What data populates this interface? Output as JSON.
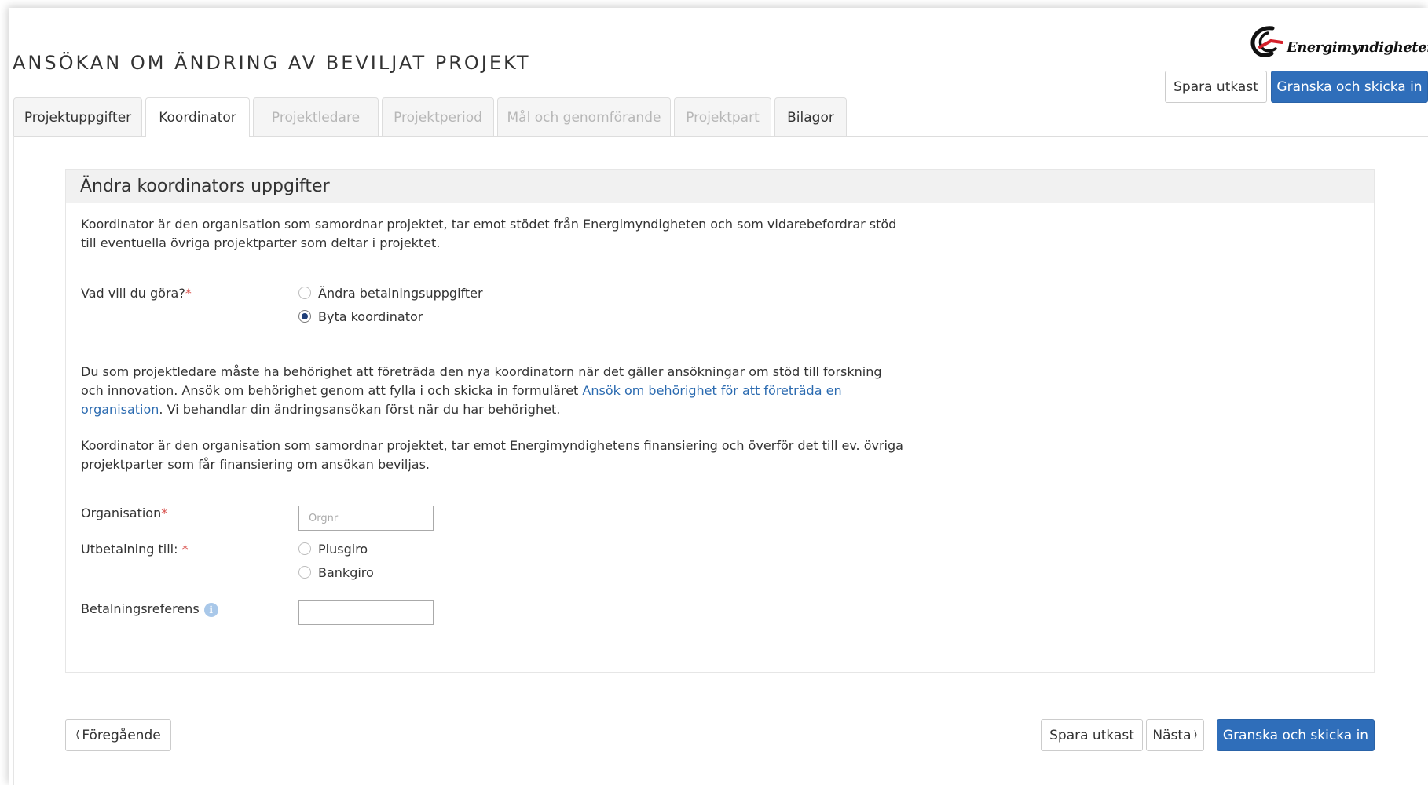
{
  "header": {
    "title": "ANSÖKAN OM ÄNDRING AV BEVILJAT PROJEKT",
    "logo_text": "Energimyndigheten",
    "save_draft_label": "Spara utkast",
    "review_submit_label": "Granska och skicka in"
  },
  "tabs": [
    {
      "label": "Projektuppgifter",
      "state": "enabled"
    },
    {
      "label": "Koordinator",
      "state": "active"
    },
    {
      "label": "Projektledare",
      "state": "disabled"
    },
    {
      "label": "Projektperiod",
      "state": "disabled"
    },
    {
      "label": "Mål och genomförande",
      "state": "disabled"
    },
    {
      "label": "Projektpart",
      "state": "disabled"
    },
    {
      "label": "Bilagor",
      "state": "enabled"
    }
  ],
  "panel": {
    "heading": "Ändra koordinators uppgifter",
    "intro": "Koordinator är den organisation som samordnar projektet, tar emot stödet från Energimyndigheten och som vidarebefordrar stöd till eventuella övriga projektparter som deltar i projektet.",
    "question_label": "Vad vill du göra?",
    "required_mark": "*",
    "options": [
      {
        "label": "Ändra betalningsuppgifter",
        "checked": false
      },
      {
        "label": "Byta koordinator",
        "checked": true
      }
    ],
    "authority_text_before": "Du som projektledare måste ha behörighet att företräda den nya koordinatorn när det gäller ansökningar om stöd till forskning och innovation. Ansök om behörighet genom att fylla i och skicka in formuläret ",
    "authority_link": "Ansök om behörighet för att företräda en organisation",
    "authority_text_after": ". Vi behandlar din ändringsansökan först när du har behörighet.",
    "financing_text": "Koordinator är den organisation som samordnar projektet, tar emot Energimyndighetens finansiering och överför det till ev. övriga projektparter som får finansiering om ansökan beviljas.",
    "organisation_label": "Organisation",
    "organisation_placeholder": "Orgnr",
    "organisation_value": "",
    "payment_label": "Utbetalning till:",
    "payment_options": [
      {
        "label": "Plusgiro",
        "checked": false
      },
      {
        "label": "Bankgiro",
        "checked": false
      }
    ],
    "reference_label": "Betalningsreferens",
    "reference_value": ""
  },
  "footer": {
    "previous_label": "Föregående",
    "save_draft_label": "Spara utkast",
    "next_label": "Nästa",
    "review_submit_label": "Granska och skicka in"
  },
  "colors": {
    "primary": "#2f6eba",
    "link": "#2a6ab0",
    "required": "#d9534f"
  },
  "icons": {
    "info": "info-icon",
    "logo": "energimyndigheten-logo-icon",
    "prev": "chevron-left-icon",
    "next": "chevron-right-icon"
  }
}
